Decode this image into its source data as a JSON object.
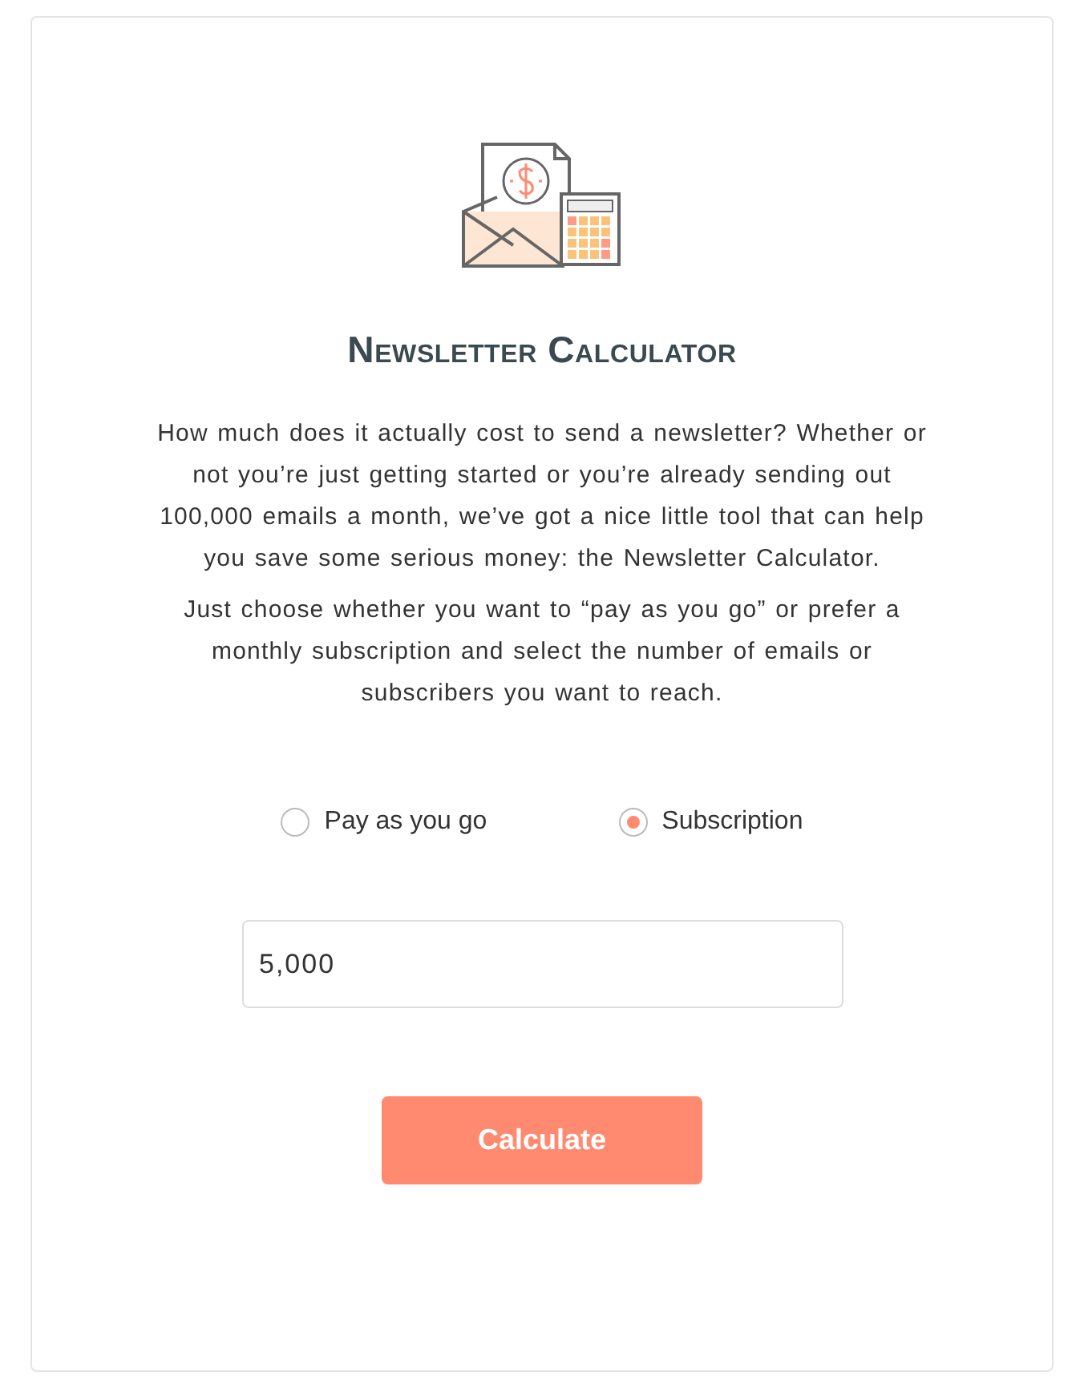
{
  "title": "Newsletter Calculator",
  "paragraphs": [
    "How much does it actually cost to send a newsletter? Whether or not you’re just getting started or you’re already sending out 100,000 emails a month, we’ve got a nice little tool that can help you save some serious money: the Newsletter Calculator.",
    "Just choose whether you want to “pay as you go” or prefer a monthly subscription and select the number of emails or subscribers you want to reach."
  ],
  "options": [
    {
      "label": "Pay as you go",
      "selected": false
    },
    {
      "label": "Subscription",
      "selected": true
    }
  ],
  "amount": {
    "value": "5,000"
  },
  "button": "Calculate"
}
